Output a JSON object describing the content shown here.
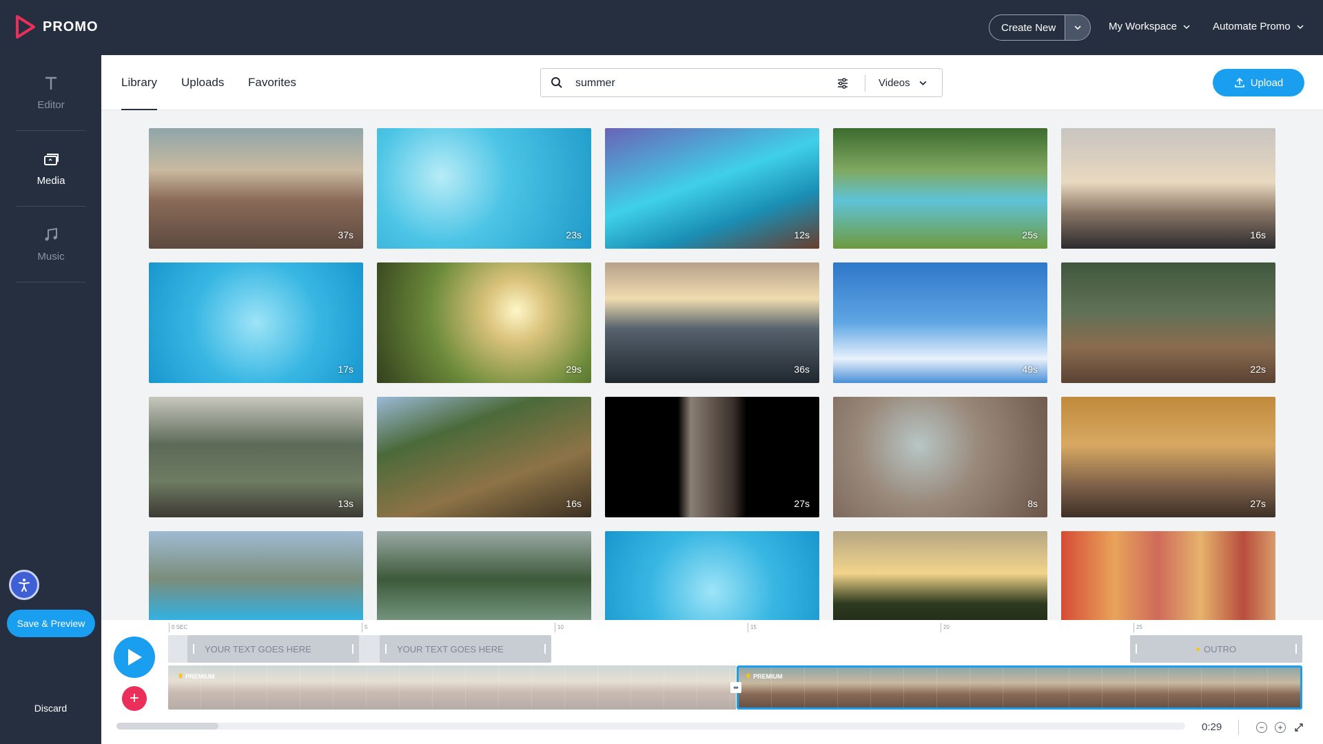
{
  "app": {
    "logo_text": "PROMO"
  },
  "topbar": {
    "create_new_label": "Create New",
    "workspace_menu": "My Workspace",
    "automate_menu": "Automate Promo"
  },
  "sidebar": {
    "items": [
      {
        "label": "Editor",
        "icon": "text-t-icon",
        "active": false
      },
      {
        "label": "Media",
        "icon": "media-stack-icon",
        "active": true
      },
      {
        "label": "Music",
        "icon": "music-note-icon",
        "active": false
      }
    ],
    "save_preview_label": "Save & Preview",
    "discard_label": "Discard"
  },
  "tabs": [
    {
      "label": "Library",
      "active": true
    },
    {
      "label": "Uploads",
      "active": false
    },
    {
      "label": "Favorites",
      "active": false
    }
  ],
  "search": {
    "value": "summer",
    "type_selected": "Videos"
  },
  "upload_label": "Upload",
  "media": [
    {
      "duration": "37s",
      "scene": "festival crowd"
    },
    {
      "duration": "23s",
      "scene": "kids swimming pool"
    },
    {
      "duration": "12s",
      "scene": "paddle board"
    },
    {
      "duration": "25s",
      "scene": "backyard pool"
    },
    {
      "duration": "16s",
      "scene": "couple on boat"
    },
    {
      "duration": "17s",
      "scene": "pool water"
    },
    {
      "duration": "29s",
      "scene": "meadow sunset"
    },
    {
      "duration": "36s",
      "scene": "sea sunset"
    },
    {
      "duration": "49s",
      "scene": "blue sky clouds"
    },
    {
      "duration": "22s",
      "scene": "porch couple"
    },
    {
      "duration": "13s",
      "scene": "house with dogs"
    },
    {
      "duration": "16s",
      "scene": "forest trail"
    },
    {
      "duration": "27s",
      "scene": "concert hand"
    },
    {
      "duration": "8s",
      "scene": "fan and woman"
    },
    {
      "duration": "27s",
      "scene": "festival dancers"
    },
    {
      "duration": "",
      "scene": "pool party"
    },
    {
      "duration": "",
      "scene": "lake kayaks"
    },
    {
      "duration": "",
      "scene": "pool water"
    },
    {
      "duration": "",
      "scene": "river sunset"
    },
    {
      "duration": "",
      "scene": "colorful town"
    }
  ],
  "timeline": {
    "ruler_labels": [
      "0 SEC",
      "5",
      "10",
      "15",
      "20",
      "25"
    ],
    "text_clips": [
      "YOUR TEXT GOES HERE",
      "YOUR TEXT GOES HERE"
    ],
    "outro_label": "OUTRO",
    "premium_label": "PREMIUM",
    "time": "0:29",
    "zoom_out": "−",
    "zoom_in": "+"
  },
  "colors": {
    "dark": "#252f3f",
    "accent": "#1a9ff0",
    "add": "#ec2e5a",
    "logo": "#ec2e5a"
  }
}
